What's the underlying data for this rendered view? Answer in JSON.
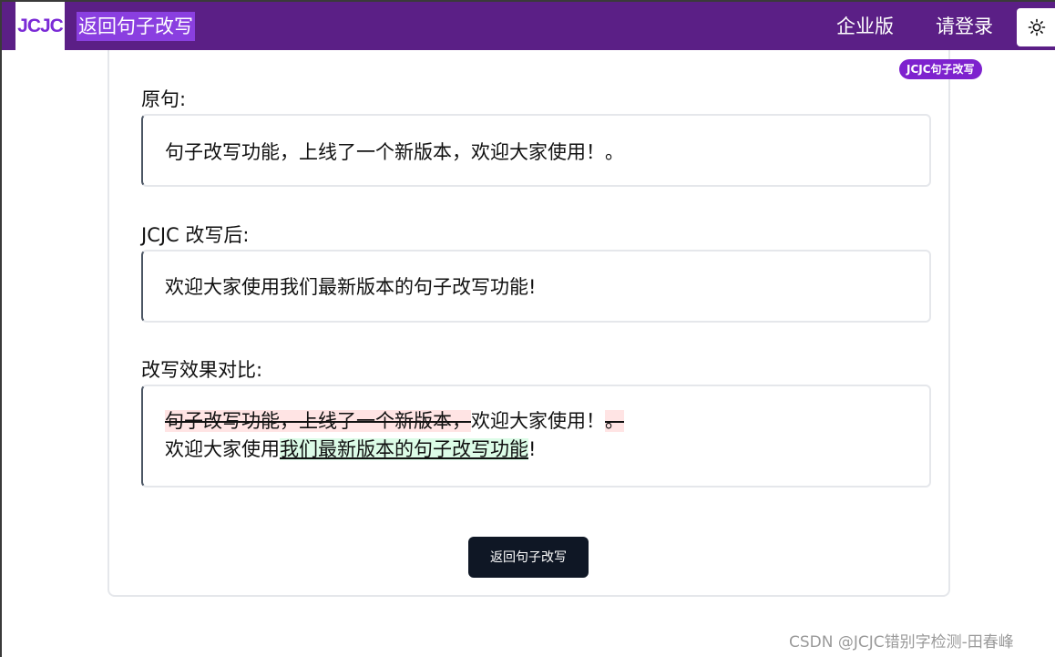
{
  "header": {
    "logo_text": "JCJC",
    "back_link": "返回句子改写",
    "nav_enterprise": "企业版",
    "nav_login": "请登录",
    "theme_icon": "sun-icon"
  },
  "badge": "JCJC句子改写",
  "original": {
    "label": "原句:",
    "text": "句子改写功能，上线了一个新版本，欢迎大家使用！。"
  },
  "rewritten": {
    "label": "JCJC 改写后:",
    "text": "欢迎大家使用我们最新版本的句子改写功能!"
  },
  "comparison": {
    "label": "改写效果对比:",
    "line1": {
      "deleted_1": "句子改写功能，上线了一个新版本，",
      "kept": "欢迎大家使用！",
      "deleted_2": "。"
    },
    "line2": {
      "kept_1": "欢迎大家使用",
      "inserted": "我们最新版本的句子改写功能",
      "kept_2": "!"
    }
  },
  "submit_button": "返回句子改写",
  "watermark": "CSDN @JCJC错别字检测-田春峰",
  "colors": {
    "header_bg": "#5b1f86",
    "accent": "#7e22ce",
    "deleted_bg": "#ffe4e4",
    "inserted_bg": "#dcfce7",
    "button_bg": "#0f1725"
  }
}
